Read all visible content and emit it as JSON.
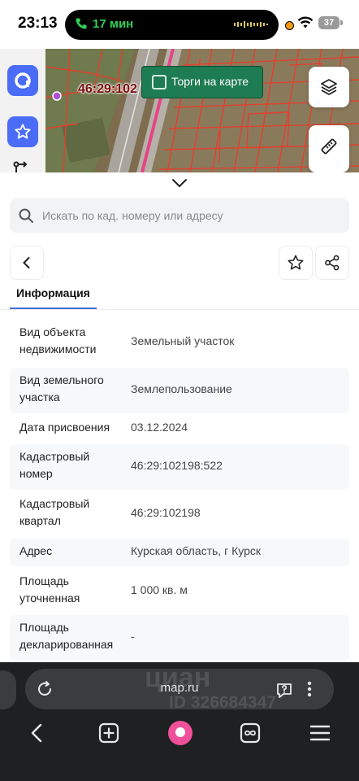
{
  "status_bar": {
    "time": "23:13",
    "call_duration": "17 мин",
    "battery": "37"
  },
  "map": {
    "cadastral_label": "46:29:102",
    "auction_toggle_label": "Торги на карте",
    "auction_toggle_checked": false
  },
  "search": {
    "placeholder": "Искать по кад. номеру или адресу"
  },
  "tabs": [
    {
      "label": "Информация",
      "active": true
    }
  ],
  "info_rows": [
    {
      "label": "Вид объекта недвижимости",
      "value": "Земельный участок"
    },
    {
      "label": "Вид земельного участка",
      "value": "Землепользование"
    },
    {
      "label": "Дата присвоения",
      "value": "03.12.2024"
    },
    {
      "label": "Кадастровый номер",
      "value": "46:29:102198:522"
    },
    {
      "label": "Кадастровый квартал",
      "value": "46:29:102198"
    },
    {
      "label": "Адрес",
      "value": "Курская область, г Курск"
    },
    {
      "label": "Площадь уточненная",
      "value": "1 000 кв. м"
    },
    {
      "label": "Площадь декларированная",
      "value": "-"
    }
  ],
  "browser": {
    "url": "map.ru",
    "watermark": "циан",
    "watermark_id": "ID 326684347"
  },
  "icons": {
    "layers": "layers-icon",
    "ruler": "ruler-icon",
    "collapse": "chevron-down-icon",
    "search": "search-icon",
    "back": "chevron-left-icon",
    "favorite": "star-icon",
    "share": "share-icon"
  },
  "colors": {
    "accent": "#3f6fd8",
    "auction_green": "#1e7c52",
    "cadastral_lines": "#e2402f",
    "alice_pink": "#f0509a"
  }
}
